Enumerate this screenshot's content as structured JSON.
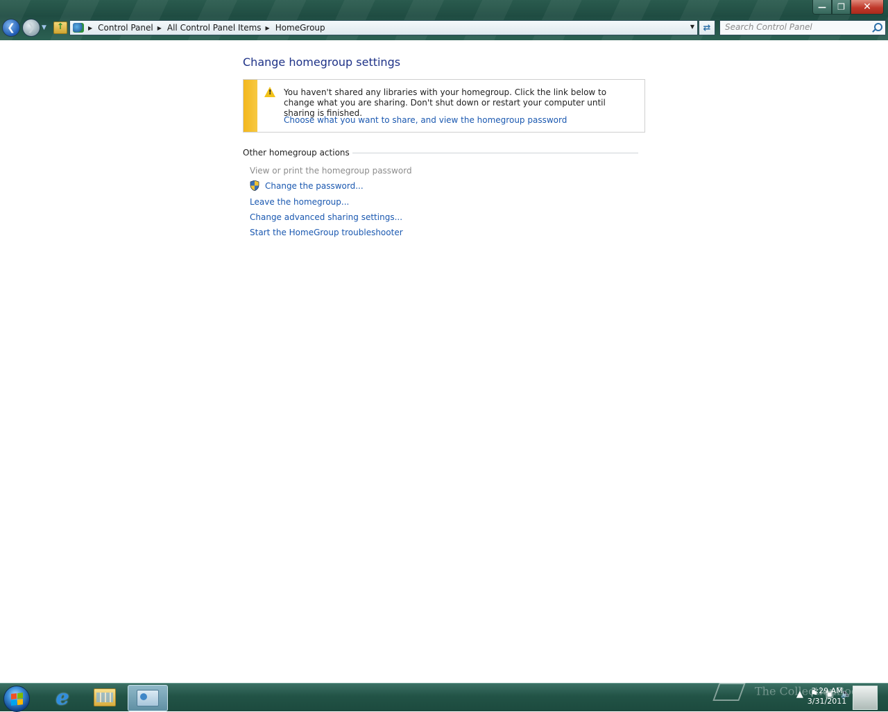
{
  "window": {
    "controls": {
      "minimize": "—",
      "maximize": "❐",
      "close": "✕"
    }
  },
  "addressbar": {
    "crumbs": [
      "Control Panel",
      "All Control Panel Items",
      "HomeGroup"
    ],
    "separator": "▶"
  },
  "search": {
    "placeholder": "Search Control Panel"
  },
  "main": {
    "title": "Change homegroup settings",
    "notice": {
      "message": "You haven't shared any libraries with your homegroup. Click the link below to change what you are sharing. Don't shut down or restart your computer until sharing is finished.",
      "link": "Choose what you want to share, and view the homegroup password"
    },
    "section_title": "Other homegroup actions",
    "actions": [
      {
        "label": "View or print the homegroup password",
        "enabled": false
      },
      {
        "label": "Change the password...",
        "enabled": true,
        "icon": "shield-icon"
      },
      {
        "label": "Leave the homegroup...",
        "enabled": true
      },
      {
        "label": "Change advanced sharing settings...",
        "enabled": true
      },
      {
        "label": "Start the HomeGroup troubleshooter",
        "enabled": true
      }
    ]
  },
  "taskbar": {
    "apps": [
      "internet-explorer-icon",
      "windows-explorer-icon",
      "control-panel-icon"
    ],
    "active_app": "control-panel-icon",
    "clock_time": "3:29 AM",
    "clock_date": "3/31/2011",
    "watermark": "The CollectionBook"
  },
  "colors": {
    "title_blue": "#1e3287",
    "link_blue": "#1a58b0",
    "notice_bar": "#f3b71d",
    "disabled": "#8c8c8c"
  }
}
